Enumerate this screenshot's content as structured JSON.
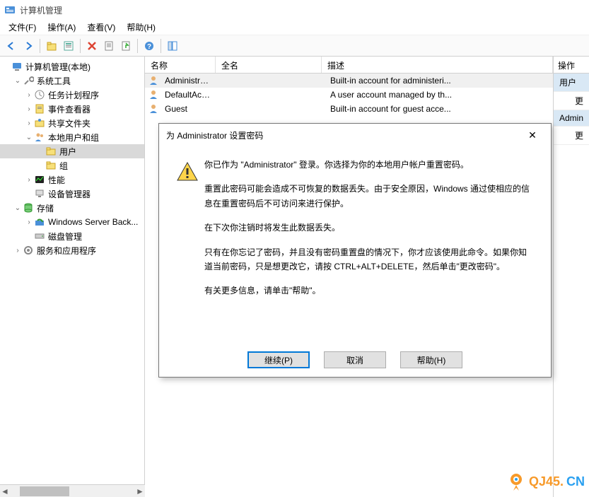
{
  "window": {
    "title": "计算机管理"
  },
  "menu": {
    "file": "文件(F)",
    "action": "操作(A)",
    "view": "查看(V)",
    "help": "帮助(H)"
  },
  "tree": {
    "root": "计算机管理(本地)",
    "system_tools": "系统工具",
    "task_scheduler": "任务计划程序",
    "event_viewer": "事件查看器",
    "shared_folders": "共享文件夹",
    "local_users_groups": "本地用户和组",
    "users": "用户",
    "groups": "组",
    "performance": "性能",
    "device_manager": "设备管理器",
    "storage": "存储",
    "wsb": "Windows Server Back...",
    "disk_mgmt": "磁盘管理",
    "services_apps": "服务和应用程序"
  },
  "columns": {
    "name": "名称",
    "fullname": "全名",
    "desc": "描述"
  },
  "users": [
    {
      "name": "Administrat...",
      "fullname": "",
      "desc": "Built-in account for administeri..."
    },
    {
      "name": "DefaultAcc...",
      "fullname": "",
      "desc": "A user account managed by th..."
    },
    {
      "name": "Guest",
      "fullname": "",
      "desc": "Built-in account for guest acce..."
    }
  ],
  "actions": {
    "header": "操作",
    "item_users": "用户",
    "item_more": "更",
    "item_admin": "Admin",
    "item_more2": "更"
  },
  "dialog": {
    "title": "为 Administrator 设置密码",
    "p1": "你已作为 \"Administrator\" 登录。你选择为你的本地用户帐户重置密码。",
    "p2": "重置此密码可能会造成不可恢复的数据丢失。由于安全原因，Windows 通过使相应的信息在重置密码后不可访问来进行保护。",
    "p3": "在下次你注销时将发生此数据丢失。",
    "p4": "只有在你忘记了密码，并且没有密码重置盘的情况下，你才应该使用此命令。如果你知道当前密码，只是想更改它，请按 CTRL+ALT+DELETE，然后单击\"更改密码\"。",
    "p5": "有关更多信息，请单击\"帮助\"。",
    "continue": "继续(P)",
    "cancel": "取消",
    "help": "帮助(H)"
  },
  "watermark": {
    "text_main": "QJ45.",
    "text_cn": "CN"
  }
}
